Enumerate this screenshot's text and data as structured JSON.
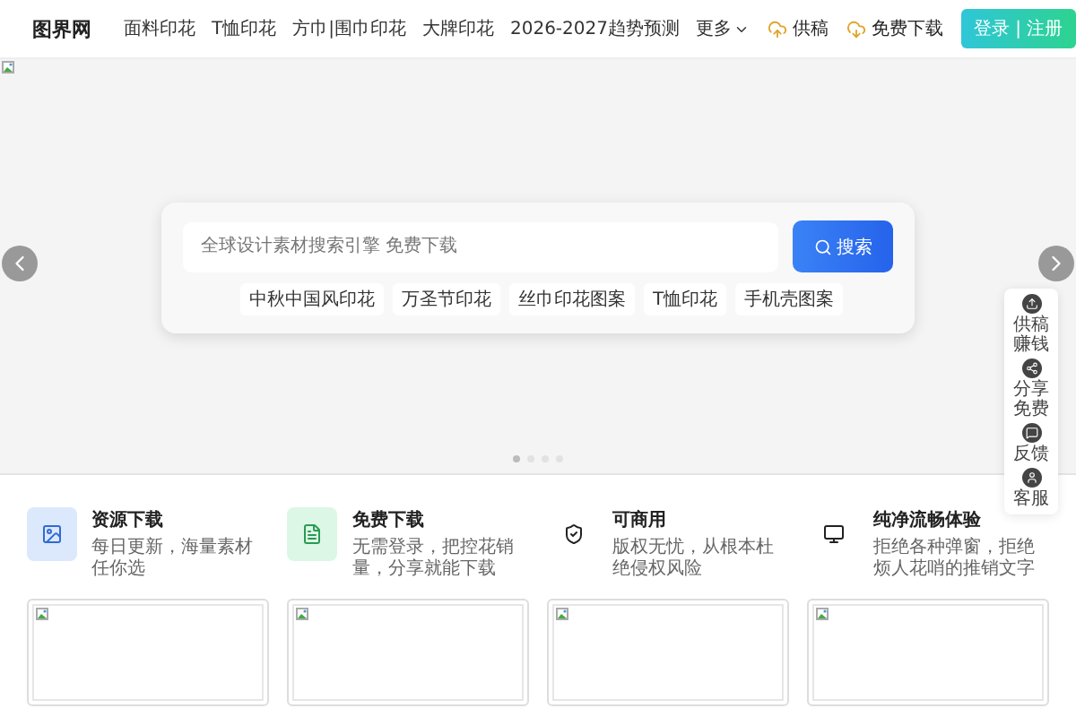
{
  "header": {
    "logo_text": "图界网",
    "nav": [
      {
        "label": "面料印花",
        "kind": "link"
      },
      {
        "label": "T恤印花",
        "kind": "link"
      },
      {
        "label": "方巾|围巾印花",
        "kind": "link"
      },
      {
        "label": "大牌印花",
        "kind": "link"
      },
      {
        "label": "2026-2027趋势预测",
        "kind": "link"
      },
      {
        "label": "更多",
        "kind": "dropdown"
      }
    ],
    "actions": [
      {
        "label": "供稿"
      },
      {
        "label": "免费下载"
      }
    ],
    "login": "登录 | 注册"
  },
  "banner": {
    "search": {
      "placeholder": "全球设计素材搜索引擎 免费下载",
      "button": "搜索"
    },
    "tags": [
      "中秋中国风印花",
      "万圣节印花",
      "丝巾印花图案",
      "T恤印花",
      "手机壳图案"
    ],
    "dots": [
      {
        "selected": true
      },
      {
        "selected": false
      },
      {
        "selected": false
      },
      {
        "selected": false
      }
    ]
  },
  "side_panel": [
    {
      "label": "供稿赚钱"
    },
    {
      "label": "分享免费"
    },
    {
      "label": "反馈"
    },
    {
      "label": "客服"
    }
  ],
  "features": [
    {
      "title": "资源下载",
      "text": "每日更新，海量素材任你选"
    },
    {
      "title": "免费下载",
      "text": "无需登录，把控花销量，分享就能下载"
    },
    {
      "title": "可商用",
      "text": "版权无忧，从根本杜绝侵权风险"
    },
    {
      "title": "纯净流畅体验",
      "text": "拒绝各种弹窗，拒绝烦人花哨的推销文字"
    }
  ],
  "cards": [
    {
      "kind": "broken-image"
    },
    {
      "kind": "broken-image"
    },
    {
      "kind": "broken-image"
    },
    {
      "kind": "broken-image"
    }
  ]
}
